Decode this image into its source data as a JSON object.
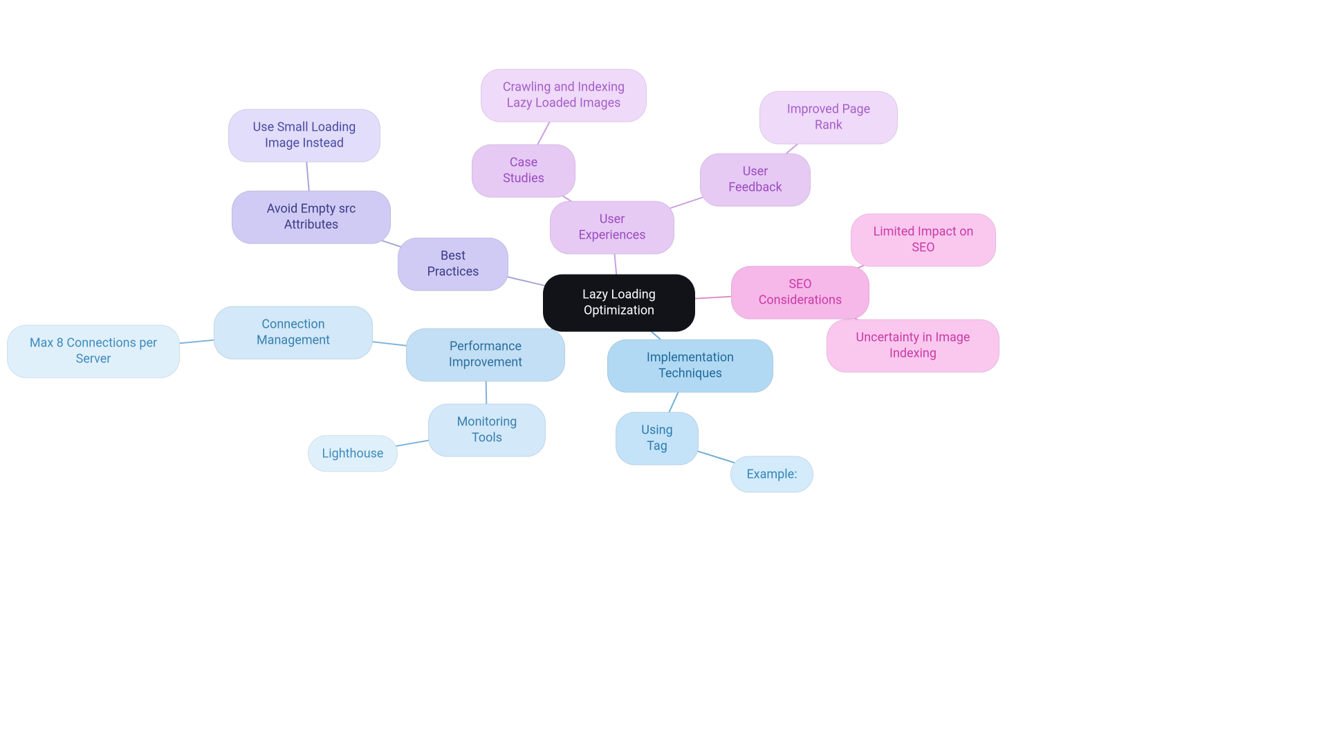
{
  "nodes": {
    "root": "Lazy Loading Optimization",
    "bestPractices": "Best Practices",
    "avoidEmptySrc": "Avoid Empty src Attributes",
    "useSmallImage": "Use Small Loading Image Instead",
    "userExperiences": "User Experiences",
    "caseStudies": "Case Studies",
    "crawlingIndexing": "Crawling and Indexing Lazy Loaded Images",
    "userFeedback": "User Feedback",
    "improvedPageRank": "Improved Page Rank",
    "seoConsiderations": "SEO Considerations",
    "limitedImpact": "Limited Impact on SEO",
    "uncertainty": "Uncertainty in Image Indexing",
    "implTechniques": "Implementation Techniques",
    "usingTag": "Using Tag",
    "example": "Example:",
    "perfImprovement": "Performance Improvement",
    "connMgmt": "Connection Management",
    "maxConn": "Max 8 Connections per Server",
    "monTools": "Monitoring Tools",
    "lighthouse": "Lighthouse"
  }
}
